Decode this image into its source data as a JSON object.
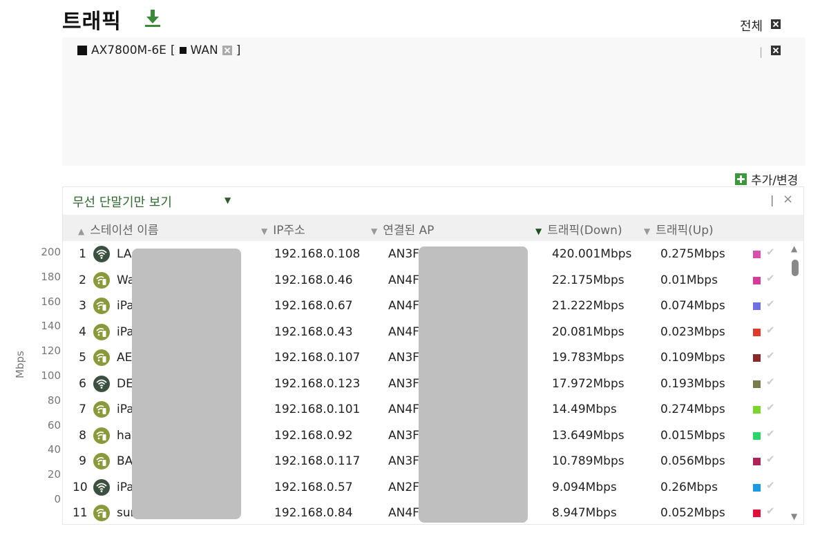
{
  "header": {
    "title": "트래픽",
    "download_icon": "download-icon"
  },
  "top_right": {
    "all_label": "전체"
  },
  "filter": {
    "device": "AX7800M-6E",
    "open_bracket": "[",
    "interface": "WAN",
    "close_bracket": "]",
    "separator": "|"
  },
  "add_change": {
    "label": "추가/변경"
  },
  "chart": {
    "ylabel": "Mbps",
    "ticks": [
      "200",
      "180",
      "160",
      "140",
      "120",
      "100",
      "80",
      "60",
      "40",
      "20",
      "0"
    ]
  },
  "dropdown": {
    "select_label": "무선 단말기만 보기",
    "separator": "|",
    "close": "×",
    "columns": {
      "name": "스테이션 이름",
      "ip": "IP주소",
      "ap": "연결된 AP",
      "down": "트래픽(Down)",
      "up": "트래픽(Up)"
    },
    "rows": [
      {
        "idx": "1",
        "icon": "wifi",
        "name": "LA",
        "ip": "192.168.0.108",
        "ap": "AN3F",
        "down": "420.001Mbps",
        "up": "0.275Mbps",
        "color": "#d94fb0"
      },
      {
        "idx": "2",
        "icon": "mobile",
        "name": "Wa",
        "ip": "192.168.0.46",
        "ap": "AN4F",
        "down": "22.175Mbps",
        "up": "0.01Mbps",
        "color": "#d63a9a"
      },
      {
        "idx": "3",
        "icon": "mobile",
        "name": "iPa",
        "ip": "192.168.0.67",
        "ap": "AN4F",
        "down": "21.222Mbps",
        "up": "0.074Mbps",
        "color": "#6f6fe8"
      },
      {
        "idx": "4",
        "icon": "mobile",
        "name": "iPa",
        "ip": "192.168.0.43",
        "ap": "AN4F",
        "down": "20.081Mbps",
        "up": "0.023Mbps",
        "color": "#e03a2a"
      },
      {
        "idx": "5",
        "icon": "mobile",
        "name": "AE",
        "ip": "192.168.0.107",
        "ap": "AN3F",
        "down": "19.783Mbps",
        "up": "0.109Mbps",
        "color": "#8a2a2a"
      },
      {
        "idx": "6",
        "icon": "wifi",
        "name": "DE",
        "ip": "192.168.0.123",
        "ap": "AN3F",
        "down": "17.972Mbps",
        "up": "0.193Mbps",
        "color": "#7a7a4a"
      },
      {
        "idx": "7",
        "icon": "mobile",
        "name": "iPa",
        "ip": "192.168.0.101",
        "ap": "AN4F",
        "down": "14.49Mbps",
        "up": "0.274Mbps",
        "color": "#7ad62a"
      },
      {
        "idx": "8",
        "icon": "mobile",
        "name": "ha",
        "ip": "192.168.0.92",
        "ap": "AN3F",
        "down": "13.649Mbps",
        "up": "0.015Mbps",
        "color": "#2ad66a"
      },
      {
        "idx": "9",
        "icon": "mobile",
        "name": "BA",
        "ip": "192.168.0.117",
        "ap": "AN3F",
        "down": "10.789Mbps",
        "up": "0.056Mbps",
        "color": "#b0205a"
      },
      {
        "idx": "10",
        "icon": "wifi",
        "name": "iPa",
        "ip": "192.168.0.57",
        "ap": "AN2F",
        "down": "9.094Mbps",
        "up": "0.26Mbps",
        "color": "#1a9ae0"
      },
      {
        "idx": "11",
        "icon": "mobile",
        "name": "sun",
        "ip": "192.168.0.84",
        "ap": "AN4F",
        "down": "8.947Mbps",
        "up": "0.052Mbps",
        "color": "#e0103a"
      }
    ]
  }
}
